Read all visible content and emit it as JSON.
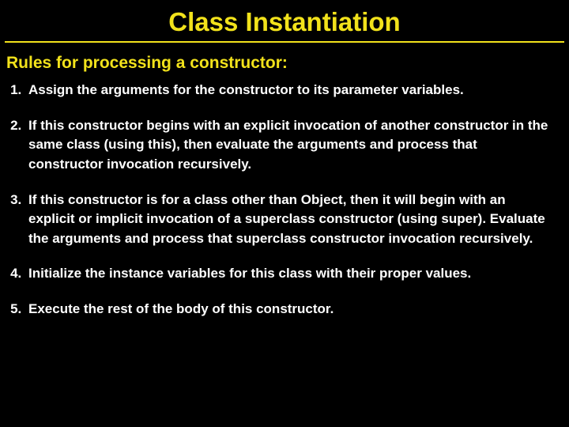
{
  "title": "Class Instantiation",
  "subtitle": "Rules for processing a constructor:",
  "rules": [
    "Assign the arguments for the constructor to its parameter variables.",
    "If this constructor begins with an explicit invocation of another constructor in the same class (using this), then evaluate the arguments and process that constructor invocation recursively.",
    "If this constructor is for a class other than Object, then it will begin with an explicit or implicit invocation of a superclass constructor (using super).  Evaluate the arguments and process that superclass constructor invocation recursively.",
    "Initialize the instance variables for this class with their proper values.",
    "Execute the rest of the body of this constructor."
  ]
}
